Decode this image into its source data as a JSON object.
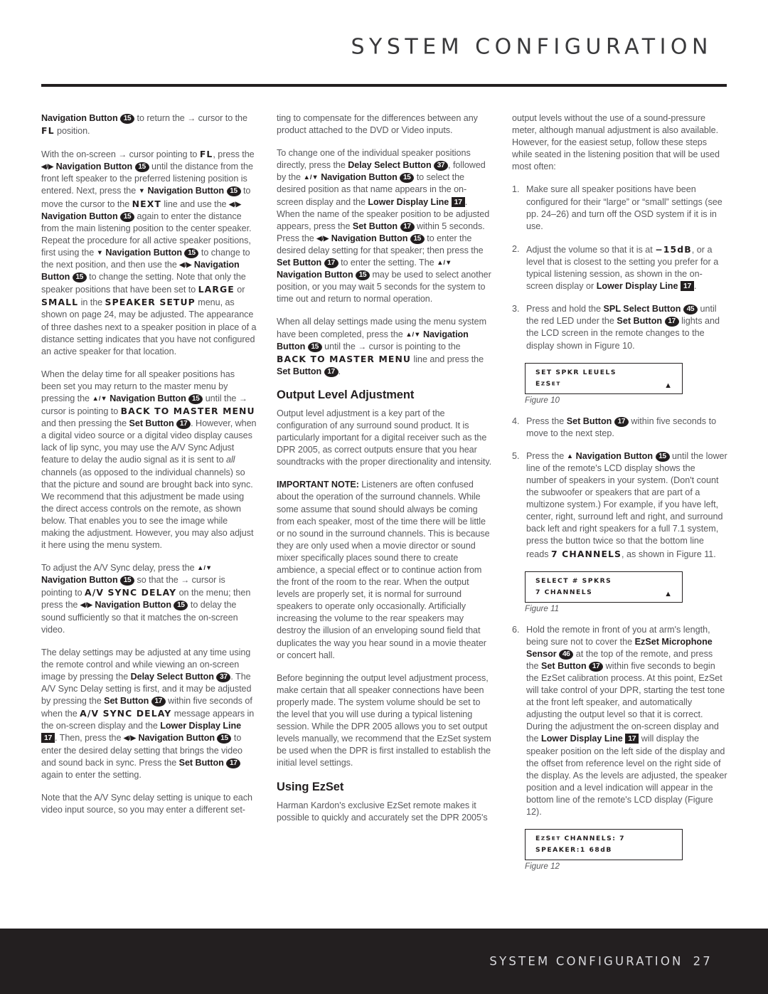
{
  "header": {
    "title": "SYSTEM CONFIGURATION"
  },
  "footer": {
    "title": "SYSTEM CONFIGURATION",
    "page_number": "27"
  },
  "column1": {
    "p1_a": "Navigation Button",
    "p1_ref1": "15",
    "p1_b": " to return the ",
    "p1_arrow": "→",
    "p1_c": " cursor to the ",
    "p1_lcd1": "FL",
    "p1_d": " position.",
    "p2_a": "With the on-screen ",
    "p2_arrow1": "→",
    "p2_b": " cursor pointing to ",
    "p2_lcd1": "FL",
    "p2_c": ", press the ",
    "p2_lr": "◀/▶",
    "p2_nav1": "Navigation Button",
    "p2_ref1": "15",
    "p2_d": " until the distance from the front left speaker to the preferred listening position is entered. Next, press the ",
    "p2_down": "▼",
    "p2_nav2": "Navigation Button",
    "p2_ref2": "15",
    "p2_e": " to move the cursor to the ",
    "p2_lcd2": "NEXT",
    "p2_f": " line and use the ",
    "p2_lr2": "◀/▶",
    "p2_nav3": "Navigation Button",
    "p2_ref3": "15",
    "p2_g": " again to enter the distance from the main listening position to the center speaker. Repeat the procedure for all active speaker positions, first using the ",
    "p2_down2": "▼",
    "p2_nav4": "Navigation Button",
    "p2_ref4": "15",
    "p2_h": " to change to the next position, and then use the ",
    "p2_lr3": "◀/▶",
    "p2_nav5": "Navigation Button",
    "p2_ref5": "15",
    "p2_i": " to change the setting. Note that only the speaker positions that have been set to ",
    "p2_lcd3": "LARGE",
    "p2_j": " or ",
    "p2_lcd4": "SMALL",
    "p2_k": " in the ",
    "p2_lcd5": "SPEAKER SETUP",
    "p2_l": " menu, as shown on page 24, may be adjusted. The appearance of three dashes next to a speaker position in place of a distance setting indicates that you have not configured an active speaker for that location.",
    "p3_a": "When the delay time for all speaker positions has been set you may return to the master menu by pressing the ",
    "p3_ud": "▲/▼",
    "p3_nav1": "Navigation Button",
    "p3_ref1": "15",
    "p3_b": " until the ",
    "p3_arrow": "→",
    "p3_c": " cursor is pointing to ",
    "p3_lcd1": "BACK TO MASTER MENU",
    "p3_d": " and then pressing the ",
    "p3_set": "Set Button",
    "p3_ref2": "17",
    "p3_e": ". However, when a digital video source or a digital video display causes lack of lip sync, you may use the A/V Sync Adjust feature to delay the audio signal as it is sent to ",
    "p3_ital": "all",
    "p3_f": " channels (as opposed to the individual channels) so that the picture and sound are brought back into sync. We recommend that this adjustment be made using the direct access controls on the remote, as shown below. That enables you to see the image while making the adjustment. However, you may also adjust it here using the menu system.",
    "p4_a": "To adjust the A/V Sync delay, press the ",
    "p4_ud": "▲/▼",
    "p4_nav1": "Navigation Button",
    "p4_ref1": "15",
    "p4_b": " so that the ",
    "p4_arrow": "→",
    "p4_c": " cursor is pointing to ",
    "p4_lcd1": "A/V SYNC DELAY",
    "p4_d": " on the menu; then press the ",
    "p4_lr": "◀/▶",
    "p4_nav2": "Navigation Button",
    "p4_ref2": "15",
    "p4_e": " to delay the sound sufficiently so that it matches the on-screen video.",
    "p5_a": "The delay settings may be adjusted at any time using the remote control and while viewing an on-screen image by pressing the ",
    "p5_dsb": "Delay Select Button",
    "p5_ref1": "37",
    "p5_b": ". The A/V Sync Delay setting is first, and it may be adjusted by pressing the ",
    "p5_set1": "Set Button",
    "p5_ref2": "17",
    "p5_c": " within five seconds of when the ",
    "p5_lcd1": "A/V SYNC DELAY",
    "p5_d": " message appears in the on-screen display and the ",
    "p5_ldl": "Lower Display Line",
    "p5_ref3": "17",
    "p5_e": ". Then, press the ",
    "p5_lr": "◀/▶",
    "p5_nav1": "Navigation Button",
    "p5_ref4": "15",
    "p5_f": " to enter the desired delay setting that brings the video and sound back in sync. Press the ",
    "p5_set2": "Set Button",
    "p5_ref5": "17",
    "p5_g": " again to enter the setting.",
    "p6_a": "Note that the A/V Sync delay setting is unique to each video input source, so you may enter a different set-"
  },
  "column2": {
    "p1_a": "ting to compensate for the differences between any product attached to the DVD or Video inputs.",
    "p2_a": "To change one of the individual speaker positions directly, press the ",
    "p2_dsb": "Delay Select Button",
    "p2_ref1": "37",
    "p2_b": ", followed by the ",
    "p2_ud": "▲/▼",
    "p2_nav1": "Navigation Button",
    "p2_ref2": "15",
    "p2_c": " to select the desired position as that name appears in the on-screen display and the ",
    "p2_ldl": "Lower Display Line",
    "p2_ref3": "17",
    "p2_d": ". When the name of the speaker position to be adjusted appears, press the ",
    "p2_set1": "Set Button",
    "p2_ref4": "17",
    "p2_e": " within 5 seconds. Press the ",
    "p2_lr": "◀/▶",
    "p2_nav2": "Navigation Button",
    "p2_ref5": "15",
    "p2_f": " to enter the desired delay setting for that speaker; then press the ",
    "p2_set2": "Set Button",
    "p2_ref6": "17",
    "p2_g": " to enter the setting. The ",
    "p2_ud2": "▲/▼",
    "p2_nav3": "Navigation Button",
    "p2_ref7": "15",
    "p2_h": " may be used to select another position, or you may wait 5 seconds for the system to time out and return to normal operation.",
    "p3_a": "When all delay settings made using the menu system have been completed, press the ",
    "p3_ud": "▲/▼",
    "p3_nav1": "Navigation Button",
    "p3_ref1": "15",
    "p3_b": " until the ",
    "p3_arrow": "→",
    "p3_c": " cursor is pointing to the ",
    "p3_lcd1": "BACK TO MASTER MENU",
    "p3_d": " line and press the ",
    "p3_set": "Set Button",
    "p3_ref2": "17",
    "p3_e": ".",
    "heading1": "Output Level Adjustment",
    "p4_a": "Output level adjustment is a key part of the configuration of any surround sound product. It is particularly important for a digital receiver such as the DPR 2005, as correct outputs ensure that you hear soundtracks with the proper directionality and intensity.",
    "p5_note": "IMPORTANT NOTE:",
    "p5_a": " Listeners are often confused about the operation of the surround channels. While some assume that sound should always be coming from each speaker, most of the time there will be little or no sound in the surround channels. This is because they are only used when a movie director or sound mixer specifically places sound there to create ambience, a special effect or to continue action from the front of the room to the rear. When the output levels are properly set, it is normal for surround speakers to operate only occasionally. Artificially increasing the volume to the rear speakers may destroy the illusion of an enveloping sound field that duplicates the way you hear sound in a movie theater or concert hall.",
    "p6_a": "Before beginning the output level adjustment process, make certain that all speaker connections have been properly made. The system volume should be set to the level that you will use during a typical listening session. While the DPR 2005 allows you to set output levels manually, we recommend that the EzSet system be used when the DPR is first installed to establish the initial level settings.",
    "heading2": "Using EzSet",
    "p7_a": "Harman Kardon's exclusive EzSet remote makes it possible to quickly and accurately set the DPR 2005's"
  },
  "column3": {
    "p1_a": "output levels without the use of a sound-pressure meter, although manual adjustment is also available. However, for the easiest setup, follow these steps while seated in the listening position that will be used most often:",
    "step1_num": "1.",
    "step1_a": "Make sure all speaker positions have been configured for their “large” or “small” settings (see pp. 24–26) and turn off the OSD system if it is in use.",
    "step2_num": "2.",
    "step2_a": "Adjust the volume so that it is at ",
    "step2_lcd": "−15dB",
    "step2_b": ", or a level that is closest to the setting you prefer for a typical listening session, as shown in the on-screen display or ",
    "step2_ldl": "Lower Display Line",
    "step2_ref": "17",
    "step2_c": ".",
    "step3_num": "3.",
    "step3_a": "Press and hold the ",
    "step3_spl": "SPL Select Button",
    "step3_ref1": "45",
    "step3_b": " until the red LED under the ",
    "step3_set": "Set Button",
    "step3_ref2": "17",
    "step3_c": " lights and the LCD screen in the remote changes to the display shown in Figure 10.",
    "figure10_line1": "SET SPKR LEUELS",
    "figure10_line2a": "E",
    "figure10_line2b": "Z",
    "figure10_line2c": "S",
    "figure10_line2d": "ET",
    "figure10_arrow": "▲",
    "figure10_caption": "Figure 10",
    "step4_num": "4.",
    "step4_a": "Press the ",
    "step4_set": "Set Button",
    "step4_ref": "17",
    "step4_b": " within five seconds to move to the next step.",
    "step5_num": "5.",
    "step5_a": "Press the ",
    "step5_up": "▲",
    "step5_nav": "Navigation Button",
    "step5_ref": "15",
    "step5_b": " until the lower line of the remote's LCD display shows the number of speakers in your system. (Don't count the subwoofer or speakers that are part of a multizone system.) For example, if you have left, center, right, surround left and right, and surround back left and right speakers for a full 7.1 system, press the button twice so that the bottom line reads ",
    "step5_lcd": "7 CHANNELS",
    "step5_c": ", as shown in Figure 11.",
    "figure11_line1": "SELECT # SPKRS",
    "figure11_line2": "7 CHANNELS",
    "figure11_arrow": "▲",
    "figure11_caption": "Figure 11",
    "step6_num": "6.",
    "step6_a": "Hold the remote in front of you at arm's length, being sure not to cover the ",
    "step6_mic": "EzSet Microphone Sensor",
    "step6_ref1": "46",
    "step6_b": " at the top of the remote, and press the ",
    "step6_set": "Set Button",
    "step6_ref2": "17",
    "step6_c": " within five seconds to begin the EzSet calibration process. At this point, EzSet will take control of your DPR, starting the test tone at the front left speaker, and automatically adjusting the output level so that it is correct. During the adjustment the on-screen display and the ",
    "step6_ldl": "Lower Display Line",
    "step6_ref3": "17",
    "step6_d": " will display the speaker position on the left side of the display and the offset from reference level on the right side of the display. As the levels are adjusted, the speaker position and a level indication will appear in the bottom line of the remote's LCD display (Figure 12).",
    "figure12_line1a": "E",
    "figure12_line1b": "Z",
    "figure12_line1c": "S",
    "figure12_line1d": "ET",
    "figure12_line1e": " CHANNELS: 7",
    "figure12_line2": "SPEAKER:1  68dB",
    "figure12_caption": "Figure 12"
  }
}
